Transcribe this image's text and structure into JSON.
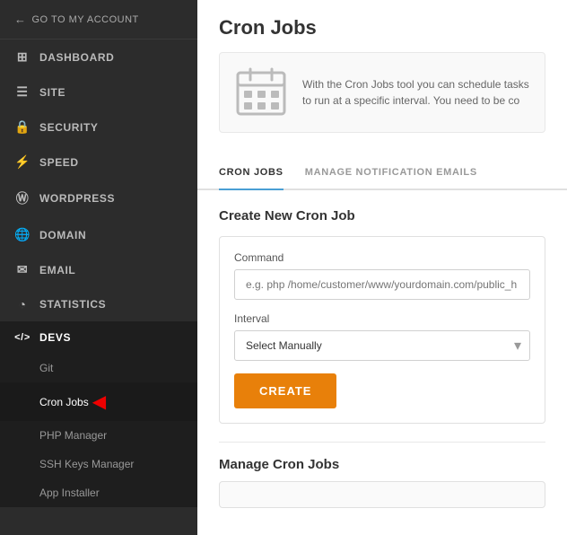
{
  "sidebar": {
    "back_label": "GO TO MY ACCOUNT",
    "nav_items": [
      {
        "id": "dashboard",
        "label": "DASHBOARD",
        "icon": "⊞"
      },
      {
        "id": "site",
        "label": "SITE",
        "icon": "☰"
      },
      {
        "id": "security",
        "label": "SECURITY",
        "icon": "🔒"
      },
      {
        "id": "speed",
        "label": "SPEED",
        "icon": "⚡"
      },
      {
        "id": "wordpress",
        "label": "WORDPRESS",
        "icon": "Ⓦ"
      },
      {
        "id": "domain",
        "label": "DOMAIN",
        "icon": "🌐"
      },
      {
        "id": "email",
        "label": "EMAIL",
        "icon": "✉"
      },
      {
        "id": "statistics",
        "label": "STATISTICS",
        "icon": "◔"
      },
      {
        "id": "devs",
        "label": "DEVS",
        "icon": "</>"
      }
    ],
    "devs_subitems": [
      {
        "id": "git",
        "label": "Git",
        "active": false
      },
      {
        "id": "cron-jobs",
        "label": "Cron Jobs",
        "active": true
      },
      {
        "id": "php-manager",
        "label": "PHP Manager",
        "active": false
      },
      {
        "id": "ssh-keys-manager",
        "label": "SSH Keys Manager",
        "active": false
      },
      {
        "id": "app-installer",
        "label": "App Installer",
        "active": false
      }
    ]
  },
  "page": {
    "title": "Cron Jobs",
    "intro_text": "With the Cron Jobs tool you can schedule tasks to run at a specific interval. You need to be co",
    "tabs": [
      {
        "id": "cron-jobs",
        "label": "CRON JOBS",
        "active": true
      },
      {
        "id": "manage-notifications",
        "label": "MANAGE NOTIFICATION EMAILS",
        "active": false
      }
    ],
    "create_section_title": "Create New Cron Job",
    "command_label": "Command",
    "command_placeholder": "e.g. php /home/customer/www/yourdomain.com/public_h",
    "interval_label": "Interval",
    "interval_value": "Select Manually",
    "create_button_label": "CREATE",
    "manage_section_title": "Manage Cron Jobs"
  }
}
